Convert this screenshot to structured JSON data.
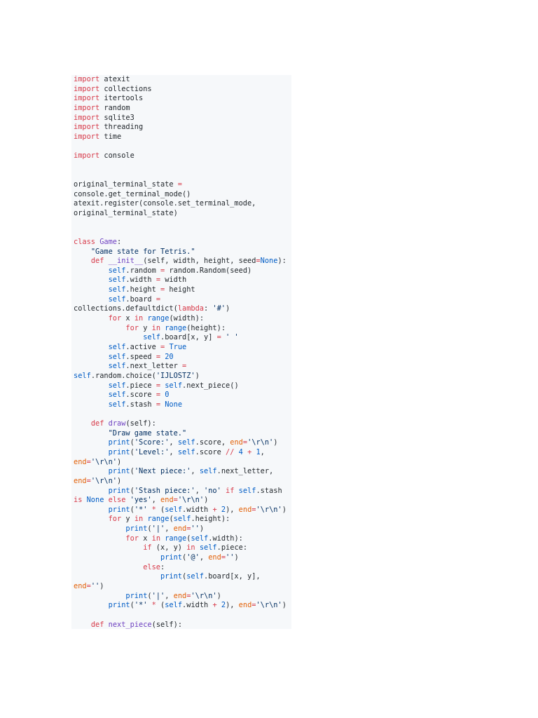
{
  "colors": {
    "plain": "#24292e",
    "keyword": "#d73a49",
    "builtin": "#005cc5",
    "string": "#032f62",
    "function": "#6f42c1",
    "kwarg": "#e36209",
    "background": "#f6f8fa"
  },
  "code_lines": [
    [
      [
        "K",
        "import"
      ],
      [
        "P",
        " atexit"
      ]
    ],
    [
      [
        "K",
        "import"
      ],
      [
        "P",
        " collections"
      ]
    ],
    [
      [
        "K",
        "import"
      ],
      [
        "P",
        " itertools"
      ]
    ],
    [
      [
        "K",
        "import"
      ],
      [
        "P",
        " random"
      ]
    ],
    [
      [
        "K",
        "import"
      ],
      [
        "P",
        " sqlite3"
      ]
    ],
    [
      [
        "K",
        "import"
      ],
      [
        "P",
        " threading"
      ]
    ],
    [
      [
        "K",
        "import"
      ],
      [
        "P",
        " time"
      ]
    ],
    [],
    [
      [
        "K",
        "import"
      ],
      [
        "P",
        " console"
      ]
    ],
    [],
    [],
    [
      [
        "P",
        "original_terminal_state "
      ],
      [
        "K",
        "="
      ]
    ],
    [
      [
        "P",
        "console.get_terminal_mode()"
      ]
    ],
    [
      [
        "P",
        "atexit.register(console.set_terminal_mode,"
      ]
    ],
    [
      [
        "P",
        "original_terminal_state)"
      ]
    ],
    [],
    [],
    [
      [
        "K",
        "class "
      ],
      [
        "F",
        "Game"
      ],
      [
        "P",
        ":"
      ]
    ],
    [
      [
        "P",
        "    "
      ],
      [
        "S",
        "\"Game state for Tetris.\""
      ]
    ],
    [
      [
        "P",
        "    "
      ],
      [
        "K",
        "def "
      ],
      [
        "F",
        "__init__"
      ],
      [
        "P",
        "(self, width, height, seed"
      ],
      [
        "K",
        "="
      ],
      [
        "B",
        "None"
      ],
      [
        "P",
        "):"
      ]
    ],
    [
      [
        "P",
        "        "
      ],
      [
        "B",
        "self"
      ],
      [
        "P",
        ".random "
      ],
      [
        "K",
        "="
      ],
      [
        "P",
        " random.Random(seed)"
      ]
    ],
    [
      [
        "P",
        "        "
      ],
      [
        "B",
        "self"
      ],
      [
        "P",
        ".width "
      ],
      [
        "K",
        "="
      ],
      [
        "P",
        " width"
      ]
    ],
    [
      [
        "P",
        "        "
      ],
      [
        "B",
        "self"
      ],
      [
        "P",
        ".height "
      ],
      [
        "K",
        "="
      ],
      [
        "P",
        " height"
      ]
    ],
    [
      [
        "P",
        "        "
      ],
      [
        "B",
        "self"
      ],
      [
        "P",
        ".board "
      ],
      [
        "K",
        "="
      ]
    ],
    [
      [
        "P",
        "collections.defaultdict("
      ],
      [
        "K",
        "lambda"
      ],
      [
        "P",
        ": "
      ],
      [
        "S",
        "'#'"
      ],
      [
        "P",
        ")"
      ]
    ],
    [
      [
        "P",
        "        "
      ],
      [
        "K",
        "for"
      ],
      [
        "P",
        " x "
      ],
      [
        "K",
        "in"
      ],
      [
        "P",
        " "
      ],
      [
        "B",
        "range"
      ],
      [
        "P",
        "(width):"
      ]
    ],
    [
      [
        "P",
        "            "
      ],
      [
        "K",
        "for"
      ],
      [
        "P",
        " y "
      ],
      [
        "K",
        "in"
      ],
      [
        "P",
        " "
      ],
      [
        "B",
        "range"
      ],
      [
        "P",
        "(height):"
      ]
    ],
    [
      [
        "P",
        "                "
      ],
      [
        "B",
        "self"
      ],
      [
        "P",
        ".board[x, y] "
      ],
      [
        "K",
        "="
      ],
      [
        "P",
        " "
      ],
      [
        "S",
        "' '"
      ]
    ],
    [
      [
        "P",
        "        "
      ],
      [
        "B",
        "self"
      ],
      [
        "P",
        ".active "
      ],
      [
        "K",
        "="
      ],
      [
        "P",
        " "
      ],
      [
        "B",
        "True"
      ]
    ],
    [
      [
        "P",
        "        "
      ],
      [
        "B",
        "self"
      ],
      [
        "P",
        ".speed "
      ],
      [
        "K",
        "="
      ],
      [
        "P",
        " "
      ],
      [
        "N",
        "20"
      ]
    ],
    [
      [
        "P",
        "        "
      ],
      [
        "B",
        "self"
      ],
      [
        "P",
        ".next_letter "
      ],
      [
        "K",
        "="
      ]
    ],
    [
      [
        "B",
        "self"
      ],
      [
        "P",
        ".random.choice("
      ],
      [
        "S",
        "'IJLOSTZ'"
      ],
      [
        "P",
        ")"
      ]
    ],
    [
      [
        "P",
        "        "
      ],
      [
        "B",
        "self"
      ],
      [
        "P",
        ".piece "
      ],
      [
        "K",
        "="
      ],
      [
        "P",
        " "
      ],
      [
        "B",
        "self"
      ],
      [
        "P",
        ".next_piece()"
      ]
    ],
    [
      [
        "P",
        "        "
      ],
      [
        "B",
        "self"
      ],
      [
        "P",
        ".score "
      ],
      [
        "K",
        "="
      ],
      [
        "P",
        " "
      ],
      [
        "N",
        "0"
      ]
    ],
    [
      [
        "P",
        "        "
      ],
      [
        "B",
        "self"
      ],
      [
        "P",
        ".stash "
      ],
      [
        "K",
        "="
      ],
      [
        "P",
        " "
      ],
      [
        "B",
        "None"
      ]
    ],
    [],
    [
      [
        "P",
        "    "
      ],
      [
        "K",
        "def "
      ],
      [
        "F",
        "draw"
      ],
      [
        "P",
        "(self):"
      ]
    ],
    [
      [
        "P",
        "        "
      ],
      [
        "S",
        "\"Draw game state.\""
      ]
    ],
    [
      [
        "P",
        "        "
      ],
      [
        "B",
        "print"
      ],
      [
        "P",
        "("
      ],
      [
        "S",
        "'Score:'"
      ],
      [
        "P",
        ", "
      ],
      [
        "B",
        "self"
      ],
      [
        "P",
        ".score, "
      ],
      [
        "O",
        "end"
      ],
      [
        "K",
        "="
      ],
      [
        "S",
        "'\\r\\n'"
      ],
      [
        "P",
        ")"
      ]
    ],
    [
      [
        "P",
        "        "
      ],
      [
        "B",
        "print"
      ],
      [
        "P",
        "("
      ],
      [
        "S",
        "'Level:'"
      ],
      [
        "P",
        ", "
      ],
      [
        "B",
        "self"
      ],
      [
        "P",
        ".score "
      ],
      [
        "K",
        "//"
      ],
      [
        "P",
        " "
      ],
      [
        "N",
        "4"
      ],
      [
        "P",
        " "
      ],
      [
        "K",
        "+"
      ],
      [
        "P",
        " "
      ],
      [
        "N",
        "1"
      ],
      [
        "P",
        ","
      ]
    ],
    [
      [
        "O",
        "end"
      ],
      [
        "K",
        "="
      ],
      [
        "S",
        "'\\r\\n'"
      ],
      [
        "P",
        ")"
      ]
    ],
    [
      [
        "P",
        "        "
      ],
      [
        "B",
        "print"
      ],
      [
        "P",
        "("
      ],
      [
        "S",
        "'Next piece:'"
      ],
      [
        "P",
        ", "
      ],
      [
        "B",
        "self"
      ],
      [
        "P",
        ".next_letter,"
      ]
    ],
    [
      [
        "O",
        "end"
      ],
      [
        "K",
        "="
      ],
      [
        "S",
        "'\\r\\n'"
      ],
      [
        "P",
        ")"
      ]
    ],
    [
      [
        "P",
        "        "
      ],
      [
        "B",
        "print"
      ],
      [
        "P",
        "("
      ],
      [
        "S",
        "'Stash piece:'"
      ],
      [
        "P",
        ", "
      ],
      [
        "S",
        "'no'"
      ],
      [
        "P",
        " "
      ],
      [
        "K",
        "if"
      ],
      [
        "P",
        " "
      ],
      [
        "B",
        "self"
      ],
      [
        "P",
        ".stash"
      ]
    ],
    [
      [
        "K",
        "is"
      ],
      [
        "P",
        " "
      ],
      [
        "B",
        "None"
      ],
      [
        "P",
        " "
      ],
      [
        "K",
        "else"
      ],
      [
        "P",
        " "
      ],
      [
        "S",
        "'yes'"
      ],
      [
        "P",
        ", "
      ],
      [
        "O",
        "end"
      ],
      [
        "K",
        "="
      ],
      [
        "S",
        "'\\r\\n'"
      ],
      [
        "P",
        ")"
      ]
    ],
    [
      [
        "P",
        "        "
      ],
      [
        "B",
        "print"
      ],
      [
        "P",
        "("
      ],
      [
        "S",
        "'*'"
      ],
      [
        "P",
        " "
      ],
      [
        "K",
        "*"
      ],
      [
        "P",
        " ("
      ],
      [
        "B",
        "self"
      ],
      [
        "P",
        ".width "
      ],
      [
        "K",
        "+"
      ],
      [
        "P",
        " "
      ],
      [
        "N",
        "2"
      ],
      [
        "P",
        "), "
      ],
      [
        "O",
        "end"
      ],
      [
        "K",
        "="
      ],
      [
        "S",
        "'\\r\\n'"
      ],
      [
        "P",
        ")"
      ]
    ],
    [
      [
        "P",
        "        "
      ],
      [
        "K",
        "for"
      ],
      [
        "P",
        " y "
      ],
      [
        "K",
        "in"
      ],
      [
        "P",
        " "
      ],
      [
        "B",
        "range"
      ],
      [
        "P",
        "("
      ],
      [
        "B",
        "self"
      ],
      [
        "P",
        ".height):"
      ]
    ],
    [
      [
        "P",
        "            "
      ],
      [
        "B",
        "print"
      ],
      [
        "P",
        "("
      ],
      [
        "S",
        "'|'"
      ],
      [
        "P",
        ", "
      ],
      [
        "O",
        "end"
      ],
      [
        "K",
        "="
      ],
      [
        "S",
        "''"
      ],
      [
        "P",
        ")"
      ]
    ],
    [
      [
        "P",
        "            "
      ],
      [
        "K",
        "for"
      ],
      [
        "P",
        " x "
      ],
      [
        "K",
        "in"
      ],
      [
        "P",
        " "
      ],
      [
        "B",
        "range"
      ],
      [
        "P",
        "("
      ],
      [
        "B",
        "self"
      ],
      [
        "P",
        ".width):"
      ]
    ],
    [
      [
        "P",
        "                "
      ],
      [
        "K",
        "if"
      ],
      [
        "P",
        " (x, y) "
      ],
      [
        "K",
        "in"
      ],
      [
        "P",
        " "
      ],
      [
        "B",
        "self"
      ],
      [
        "P",
        ".piece:"
      ]
    ],
    [
      [
        "P",
        "                    "
      ],
      [
        "B",
        "print"
      ],
      [
        "P",
        "("
      ],
      [
        "S",
        "'@'"
      ],
      [
        "P",
        ", "
      ],
      [
        "O",
        "end"
      ],
      [
        "K",
        "="
      ],
      [
        "S",
        "''"
      ],
      [
        "P",
        ")"
      ]
    ],
    [
      [
        "P",
        "                "
      ],
      [
        "K",
        "else"
      ],
      [
        "P",
        ":"
      ]
    ],
    [
      [
        "P",
        "                    "
      ],
      [
        "B",
        "print"
      ],
      [
        "P",
        "("
      ],
      [
        "B",
        "self"
      ],
      [
        "P",
        ".board[x, y],"
      ]
    ],
    [
      [
        "O",
        "end"
      ],
      [
        "K",
        "="
      ],
      [
        "S",
        "''"
      ],
      [
        "P",
        ")"
      ]
    ],
    [
      [
        "P",
        "            "
      ],
      [
        "B",
        "print"
      ],
      [
        "P",
        "("
      ],
      [
        "S",
        "'|'"
      ],
      [
        "P",
        ", "
      ],
      [
        "O",
        "end"
      ],
      [
        "K",
        "="
      ],
      [
        "S",
        "'\\r\\n'"
      ],
      [
        "P",
        ")"
      ]
    ],
    [
      [
        "P",
        "        "
      ],
      [
        "B",
        "print"
      ],
      [
        "P",
        "("
      ],
      [
        "S",
        "'*'"
      ],
      [
        "P",
        " "
      ],
      [
        "K",
        "*"
      ],
      [
        "P",
        " ("
      ],
      [
        "B",
        "self"
      ],
      [
        "P",
        ".width "
      ],
      [
        "K",
        "+"
      ],
      [
        "P",
        " "
      ],
      [
        "N",
        "2"
      ],
      [
        "P",
        "), "
      ],
      [
        "O",
        "end"
      ],
      [
        "K",
        "="
      ],
      [
        "S",
        "'\\r\\n'"
      ],
      [
        "P",
        ")"
      ]
    ],
    [],
    [
      [
        "P",
        "    "
      ],
      [
        "K",
        "def "
      ],
      [
        "F",
        "next_piece"
      ],
      [
        "P",
        "(self):"
      ]
    ]
  ]
}
